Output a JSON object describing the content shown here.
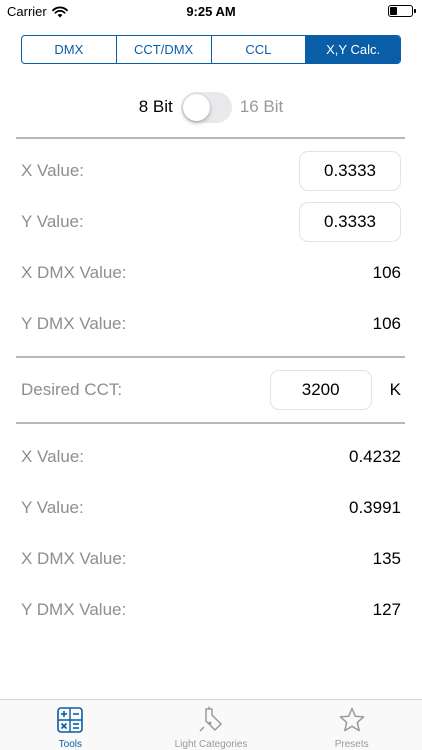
{
  "status_bar": {
    "carrier": "Carrier",
    "time": "9:25 AM"
  },
  "segments": [
    "DMX",
    "CCT/DMX",
    "CCL",
    "X,Y Calc."
  ],
  "active_segment": "X,Y Calc.",
  "bit_toggle": {
    "left_label": "8 Bit",
    "right_label": "16 Bit",
    "is_on": false
  },
  "input_section": {
    "x_label": "X Value:",
    "x_value": "0.3333",
    "y_label": "Y Value:",
    "y_value": "0.3333",
    "x_dmx_label": "X DMX Value:",
    "x_dmx_value": "106",
    "y_dmx_label": "Y DMX Value:",
    "y_dmx_value": "106"
  },
  "cct_section": {
    "label": "Desired CCT:",
    "value": "3200",
    "unit": "K"
  },
  "result_section": {
    "x_label": "X Value:",
    "x_value": "0.4232",
    "y_label": "Y Value:",
    "y_value": "0.3991",
    "x_dmx_label": "X DMX Value:",
    "x_dmx_value": "135",
    "y_dmx_label": "Y DMX Value:",
    "y_dmx_value": "127"
  },
  "tab_bar": {
    "items": [
      {
        "label": "Tools",
        "icon": "calculator-icon"
      },
      {
        "label": "Light Categories",
        "icon": "lamp-icon"
      },
      {
        "label": "Presets",
        "icon": "star-icon"
      }
    ],
    "active": "Tools"
  },
  "colors": {
    "accent": "#0a5ea8",
    "label_gray": "#8e8e93",
    "divider": "#b9b9b9"
  }
}
